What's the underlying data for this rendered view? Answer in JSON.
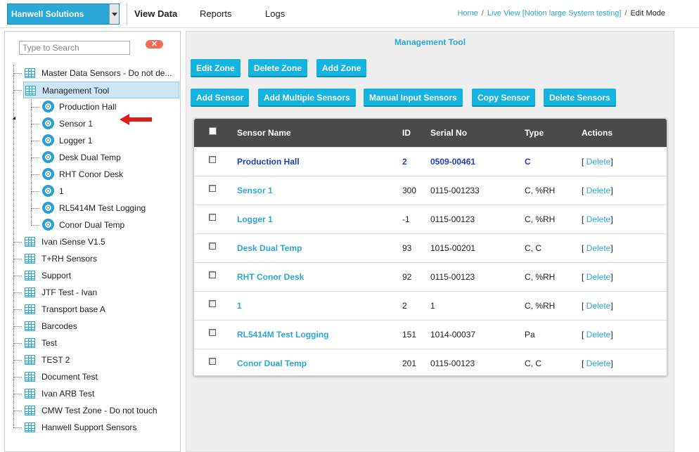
{
  "header": {
    "company": "Hanwell Solutions",
    "nav": [
      "View Data",
      "Reports",
      "Logs"
    ],
    "breadcrumb": [
      "Home",
      "Live View [Notion large System testing]",
      "Edit Mode"
    ]
  },
  "sidebar": {
    "search_placeholder": "Type to Search",
    "clear_label": "✕",
    "tree": [
      {
        "label": "Master Data Sensors - Do not de...",
        "type": "zone"
      },
      {
        "label": "Management Tool",
        "type": "zone",
        "selected": true
      },
      {
        "label": "Production Hall",
        "type": "sensor"
      },
      {
        "label": "Sensor 1",
        "type": "sensor"
      },
      {
        "label": "Logger 1",
        "type": "sensor"
      },
      {
        "label": "Desk Dual Temp",
        "type": "sensor"
      },
      {
        "label": "RHT Conor Desk",
        "type": "sensor"
      },
      {
        "label": "1",
        "type": "sensor"
      },
      {
        "label": "RL5414M Test Logging",
        "type": "sensor"
      },
      {
        "label": "Conor Dual Temp",
        "type": "sensor"
      },
      {
        "label": "Ivan iSense V1.5",
        "type": "zone"
      },
      {
        "label": "T+RH Sensors",
        "type": "zone"
      },
      {
        "label": "Support",
        "type": "zone"
      },
      {
        "label": "JTF Test - Ivan",
        "type": "zone"
      },
      {
        "label": "Transport base A",
        "type": "zone"
      },
      {
        "label": "Barcodes",
        "type": "zone"
      },
      {
        "label": "Test",
        "type": "zone"
      },
      {
        "label": "TEST 2",
        "type": "zone"
      },
      {
        "label": "Document Test",
        "type": "zone"
      },
      {
        "label": "Ivan ARB Test",
        "type": "zone"
      },
      {
        "label": "CMW Test Zone - Do not touch",
        "type": "zone"
      },
      {
        "label": "Hanwell Support Sensors",
        "type": "zone"
      }
    ]
  },
  "main": {
    "title": "Management Tool",
    "zone_buttons": [
      "Edit Zone",
      "Delete Zone",
      "Add Zone"
    ],
    "sensor_buttons": [
      "Add Sensor",
      "Add Multiple Sensors",
      "Manual Input Sensors",
      "Copy Sensor",
      "Delete Sensors"
    ],
    "table": {
      "columns": [
        "Sensor Name",
        "ID",
        "Serial No",
        "Type",
        "Actions"
      ],
      "delete_label": "Delete",
      "rows": [
        {
          "name": "Production Hall",
          "id": "2",
          "serial": "0509-00461",
          "type": "C",
          "highlight": true
        },
        {
          "name": "Sensor 1",
          "id": "300",
          "serial": "0115-001233",
          "type": "C, %RH"
        },
        {
          "name": "Logger 1",
          "id": "-1",
          "serial": "0115-00123",
          "type": "C, %RH"
        },
        {
          "name": "Desk Dual Temp",
          "id": "93",
          "serial": "1015-00201",
          "type": "C, C"
        },
        {
          "name": "RHT Conor Desk",
          "id": "92",
          "serial": "0115-00123",
          "type": "C, %RH"
        },
        {
          "name": "1",
          "id": "2",
          "serial": "1",
          "type": "C, %RH"
        },
        {
          "name": "RL5414M Test Logging",
          "id": "151",
          "serial": "1014-00037",
          "type": "Pa"
        },
        {
          "name": "Conor Dual Temp",
          "id": "201",
          "serial": "0115-00123",
          "type": "C, C"
        }
      ]
    }
  }
}
